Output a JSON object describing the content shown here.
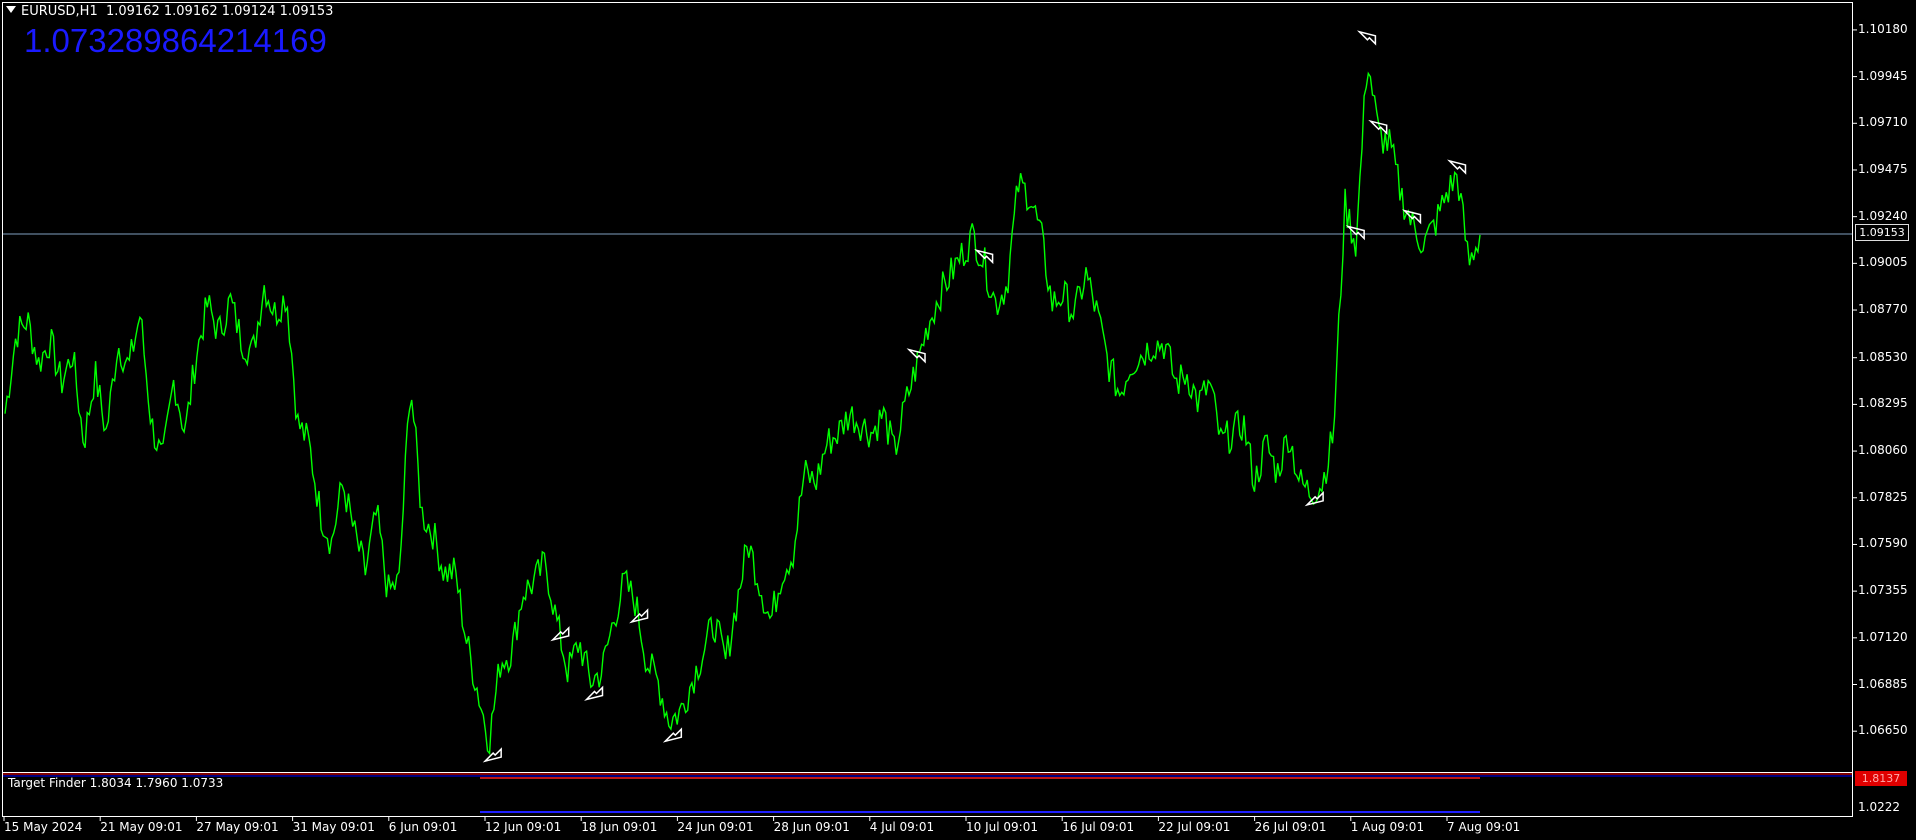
{
  "header": {
    "symbol": "EURUSD,H1",
    "ohlc": "1.09162 1.09162 1.09124 1.09153"
  },
  "overlay_value": "1.073289864214169",
  "indicator": {
    "label": "Target Finder 1.8034 1.7960 1.0733",
    "price_tag": "1.8137",
    "axis_value": "1.0222"
  },
  "current_price": "1.09153",
  "colors": {
    "background": "#000000",
    "price_line": "#00ff00",
    "current_line": "#7f9fbf",
    "overlay_text": "#1a1aff",
    "indicator_line_top": "#ff0000",
    "indicator_line_bottom": "#0000ff",
    "marker": "#ffffff"
  },
  "chart_data": {
    "type": "line",
    "title": "EURUSD,H1",
    "y_ticks": [
      "1.10180",
      "1.09945",
      "1.09710",
      "1.09475",
      "1.09240",
      "1.09005",
      "1.08770",
      "1.08530",
      "1.08295",
      "1.08060",
      "1.07825",
      "1.07590",
      "1.07355",
      "1.07120",
      "1.06885",
      "1.06650"
    ],
    "x_ticks": [
      "15 May 2024",
      "21 May 09:01",
      "27 May 09:01",
      "31 May 09:01",
      "6 Jun 09:01",
      "12 Jun 09:01",
      "18 Jun 09:01",
      "24 Jun 09:01",
      "28 Jun 09:01",
      "4 Jul 09:01",
      "10 Jul 09:01",
      "16 Jul 09:01",
      "22 Jul 09:01",
      "26 Jul 09:01",
      "1 Aug 09:01",
      "7 Aug 09:01"
    ],
    "ylim": [
      1.0651,
      1.1024
    ],
    "series": [
      {
        "values": [
          1.0825,
          1.0865,
          1.0872,
          1.085,
          1.0862,
          1.084,
          1.0855,
          1.081,
          1.0845,
          1.0815,
          1.086,
          1.0848,
          1.0875,
          1.082,
          1.08,
          1.0842,
          1.0815,
          1.0855,
          1.088,
          1.0865,
          1.0882,
          1.0862,
          1.0855,
          1.089,
          1.0875,
          1.0885,
          1.082,
          1.081,
          1.0775,
          1.076,
          1.079,
          1.0765,
          1.0745,
          1.0775,
          1.0735,
          1.074,
          1.0842,
          1.0775,
          1.0765,
          1.0745,
          1.0745,
          1.071,
          1.0685,
          1.066,
          1.07,
          1.0705,
          1.0735,
          1.074,
          1.075,
          1.072,
          1.0695,
          1.071,
          1.069,
          1.0695,
          1.072,
          1.074,
          1.073,
          1.07,
          1.069,
          1.067,
          1.0675,
          1.069,
          1.0705,
          1.072,
          1.07,
          1.073,
          1.076,
          1.074,
          1.072,
          1.0745,
          1.0755,
          1.0795,
          1.079,
          1.081,
          1.0815,
          1.0825,
          1.082,
          1.0815,
          1.0825,
          1.0805,
          1.083,
          1.085,
          1.087,
          1.0885,
          1.0895,
          1.0905,
          1.0915,
          1.09,
          1.088,
          1.089,
          1.094,
          1.0935,
          1.0915,
          1.088,
          1.0885,
          1.0875,
          1.0895,
          1.0875,
          1.085,
          1.0835,
          1.085,
          1.0855,
          1.086,
          1.086,
          1.084,
          1.0845,
          1.083,
          1.084,
          1.081,
          1.0815,
          1.082,
          1.079,
          1.081,
          1.0795,
          1.0815,
          1.079,
          1.0785,
          1.079,
          1.0815,
          1.093,
          1.091,
          1.1005,
          1.0965,
          1.096,
          1.0935,
          1.092,
          1.091,
          1.092,
          1.0935,
          1.0945,
          1.09,
          1.0915
        ]
      }
    ],
    "arrows_up": [
      [
        1.0727,
        1.0735
      ],
      [
        1.0718,
        1.0705
      ],
      [
        1.0688,
        1.0695
      ],
      [
        1.0667,
        1.0675
      ],
      [
        1.0657,
        1.0663
      ],
      [
        1.0786,
        1.079
      ]
    ],
    "arrows_down": [
      [
        1.085,
        1.085
      ],
      [
        1.09,
        1.09
      ],
      [
        1.0912,
        1.0912
      ],
      [
        1.092,
        1.092
      ],
      [
        1.0945,
        1.0945
      ],
      [
        1.0965,
        1.0965
      ],
      [
        1.101,
        1.101
      ]
    ],
    "grid": false
  }
}
